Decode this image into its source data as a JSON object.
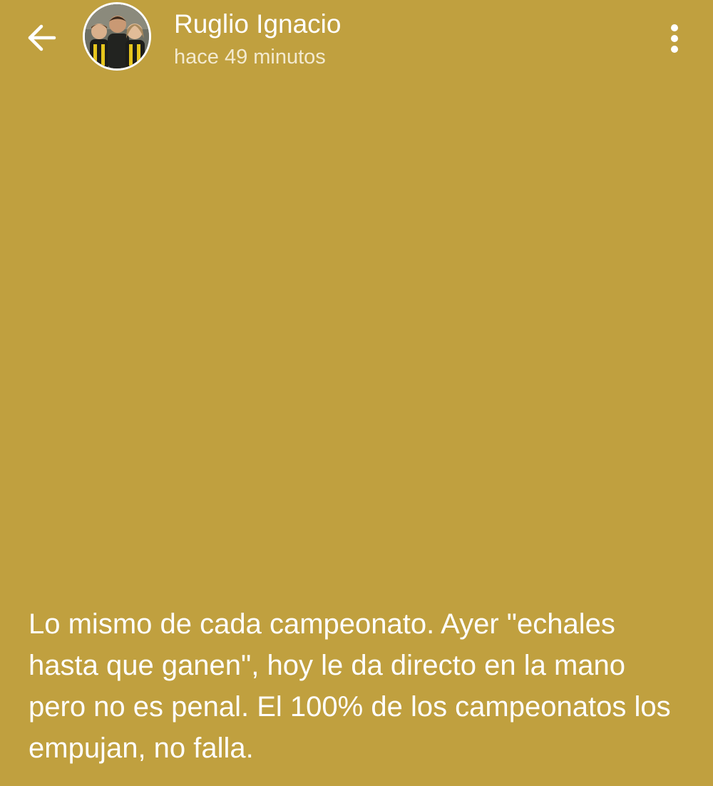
{
  "header": {
    "back_icon": "arrow-left-icon",
    "user_name": "Ruglio Ignacio",
    "timestamp": "hace 49 minutos",
    "menu_icon": "more-vertical-icon",
    "avatar": "profile photo of a man with two children wearing black and yellow shirts"
  },
  "status": {
    "text": "Lo mismo de cada campeonato. Ayer \"echales hasta que ganen\", hoy le da directo en la mano pero no es penal. El 100% de los campeonatos los empujan, no falla."
  },
  "colors": {
    "background": "#c0a03f",
    "text": "#ffffff"
  }
}
